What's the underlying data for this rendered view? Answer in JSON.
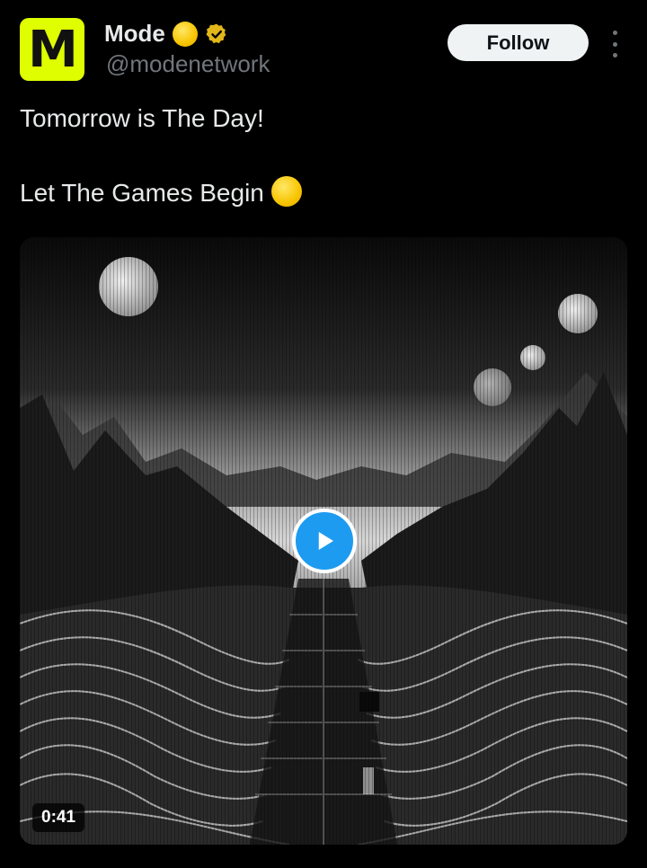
{
  "author": {
    "avatar_letter": "M",
    "avatar_color": "#dffe00",
    "display_name": "Mode",
    "name_emoji": "yellow-circle-emoji",
    "badge": "verified-gold-badge-icon",
    "handle": "@modenetwork"
  },
  "actions": {
    "follow_label": "Follow",
    "more_icon": "more-options-icon"
  },
  "tweet": {
    "lines": [
      "Tomorrow is The Day!",
      "Let The Games Begin"
    ],
    "trailing_emoji": "yellow-circle-emoji"
  },
  "media": {
    "type": "video",
    "description_icon": "play-icon",
    "duration": "0:41"
  },
  "colors": {
    "background": "#000000",
    "text": "#e7e9ea",
    "secondary_text": "#71767b",
    "accent": "#1d9bf0",
    "badge_gold": "#e2b719"
  }
}
